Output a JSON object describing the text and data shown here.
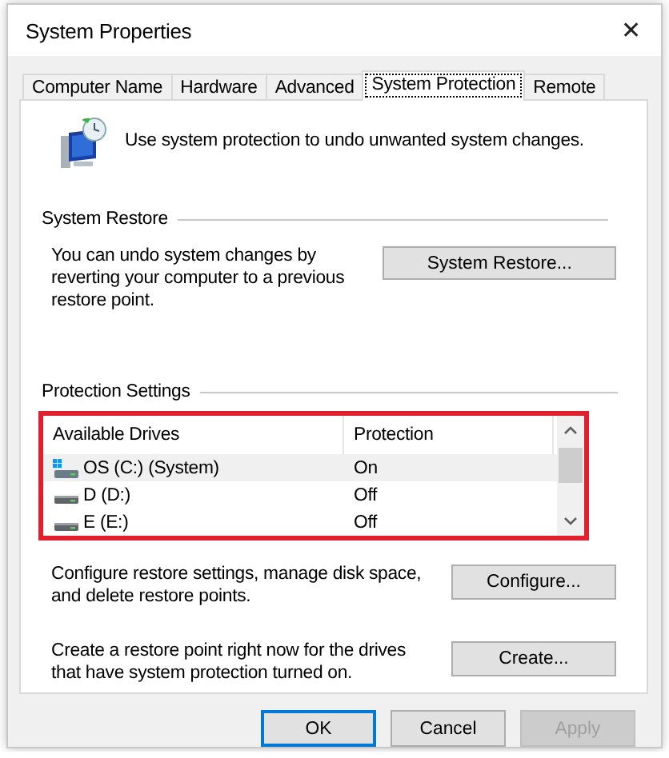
{
  "window": {
    "title": "System Properties",
    "close": "✕"
  },
  "tabs": [
    {
      "label": "Computer Name",
      "selected": false
    },
    {
      "label": "Hardware",
      "selected": false
    },
    {
      "label": "Advanced",
      "selected": false
    },
    {
      "label": "System Protection",
      "selected": true
    },
    {
      "label": "Remote",
      "selected": false
    }
  ],
  "intro": "Use system protection to undo unwanted system changes.",
  "system_restore": {
    "heading": "System Restore",
    "text": "You can undo system changes by reverting your computer to a previous restore point.",
    "button": "System Restore..."
  },
  "protection_settings": {
    "heading": "Protection Settings",
    "highlighted": true,
    "columns": [
      "Available Drives",
      "Protection"
    ],
    "rows": [
      {
        "drive": "OS (C:) (System)",
        "protection": "On",
        "kind": "system",
        "selected": true
      },
      {
        "drive": "D (D:)",
        "protection": "Off",
        "kind": "disk",
        "selected": false
      },
      {
        "drive": "E (E:)",
        "protection": "Off",
        "kind": "disk",
        "selected": false
      }
    ],
    "configure": {
      "text": "Configure restore settings, manage disk space, and delete restore points.",
      "button": "Configure..."
    },
    "create": {
      "text": "Create a restore point right now for the drives that have system protection turned on.",
      "button": "Create..."
    }
  },
  "buttons": [
    {
      "label": "OK",
      "default": true,
      "disabled": false
    },
    {
      "label": "Cancel",
      "default": false,
      "disabled": false
    },
    {
      "label": "Apply",
      "default": false,
      "disabled": true
    }
  ]
}
